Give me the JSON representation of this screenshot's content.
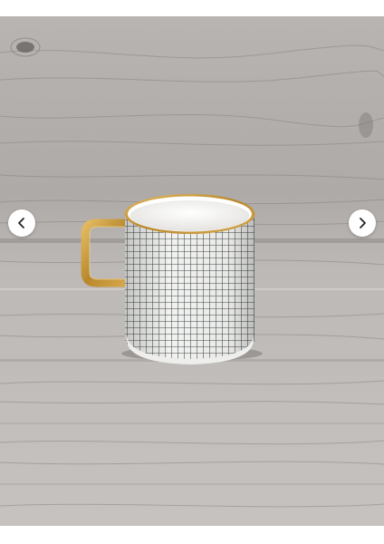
{
  "gallery": {
    "photo_alt": "",
    "colors": {
      "wood_light": "#c9c5c3",
      "wood_mid": "#aca8a6",
      "wood_dark": "#6e6a68",
      "mug_white": "#f4f4f2",
      "grid_line": "#3f4a4a",
      "gold_trim": "#c99a3a",
      "button_bg": "#ffffff"
    },
    "prev_icon": "chevron-left-icon",
    "next_icon": "chevron-right-icon"
  }
}
